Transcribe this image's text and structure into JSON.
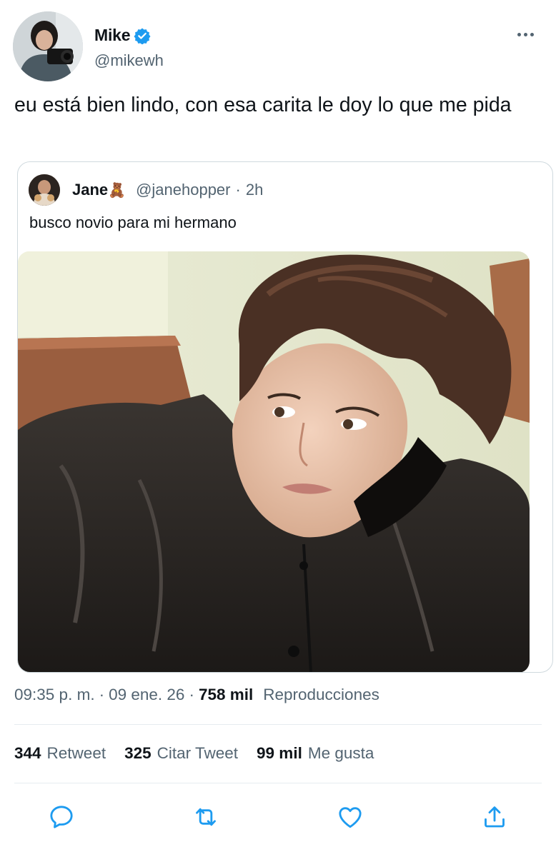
{
  "author": {
    "display_name": "Mike",
    "handle": "@mikewh",
    "verified": true
  },
  "tweet": {
    "text": "eu está bien lindo, con esa carita le doy lo que me pida"
  },
  "quoted_tweet": {
    "display_name": "Jane",
    "name_emoji": "🧸",
    "handle": "@janehopper",
    "separator": "·",
    "time_ago": "2h",
    "text": "busco novio para mi hermano"
  },
  "meta": {
    "time": "09:35 p. m.",
    "sep1": "·",
    "date": "09 ene. 26",
    "sep2": "·",
    "views_count": "758 mil",
    "views_label": "Reproducciones"
  },
  "stats": {
    "retweets_count": "344",
    "retweets_label": "Retweet",
    "quotes_count": "325",
    "quotes_label": "Citar Tweet",
    "likes_count": "99 mil",
    "likes_label": "Me gusta"
  },
  "icons": {
    "verified": "verified-badge-icon",
    "more": "more-icon",
    "reply": "reply-icon",
    "retweet": "retweet-icon",
    "like": "heart-icon",
    "share": "share-icon"
  },
  "colors": {
    "verified_blue": "#1d9bf0",
    "secondary_text": "#536471",
    "primary_text": "#0f1419",
    "border": "#cfd9de",
    "action_icon": "#1d9bf0"
  }
}
